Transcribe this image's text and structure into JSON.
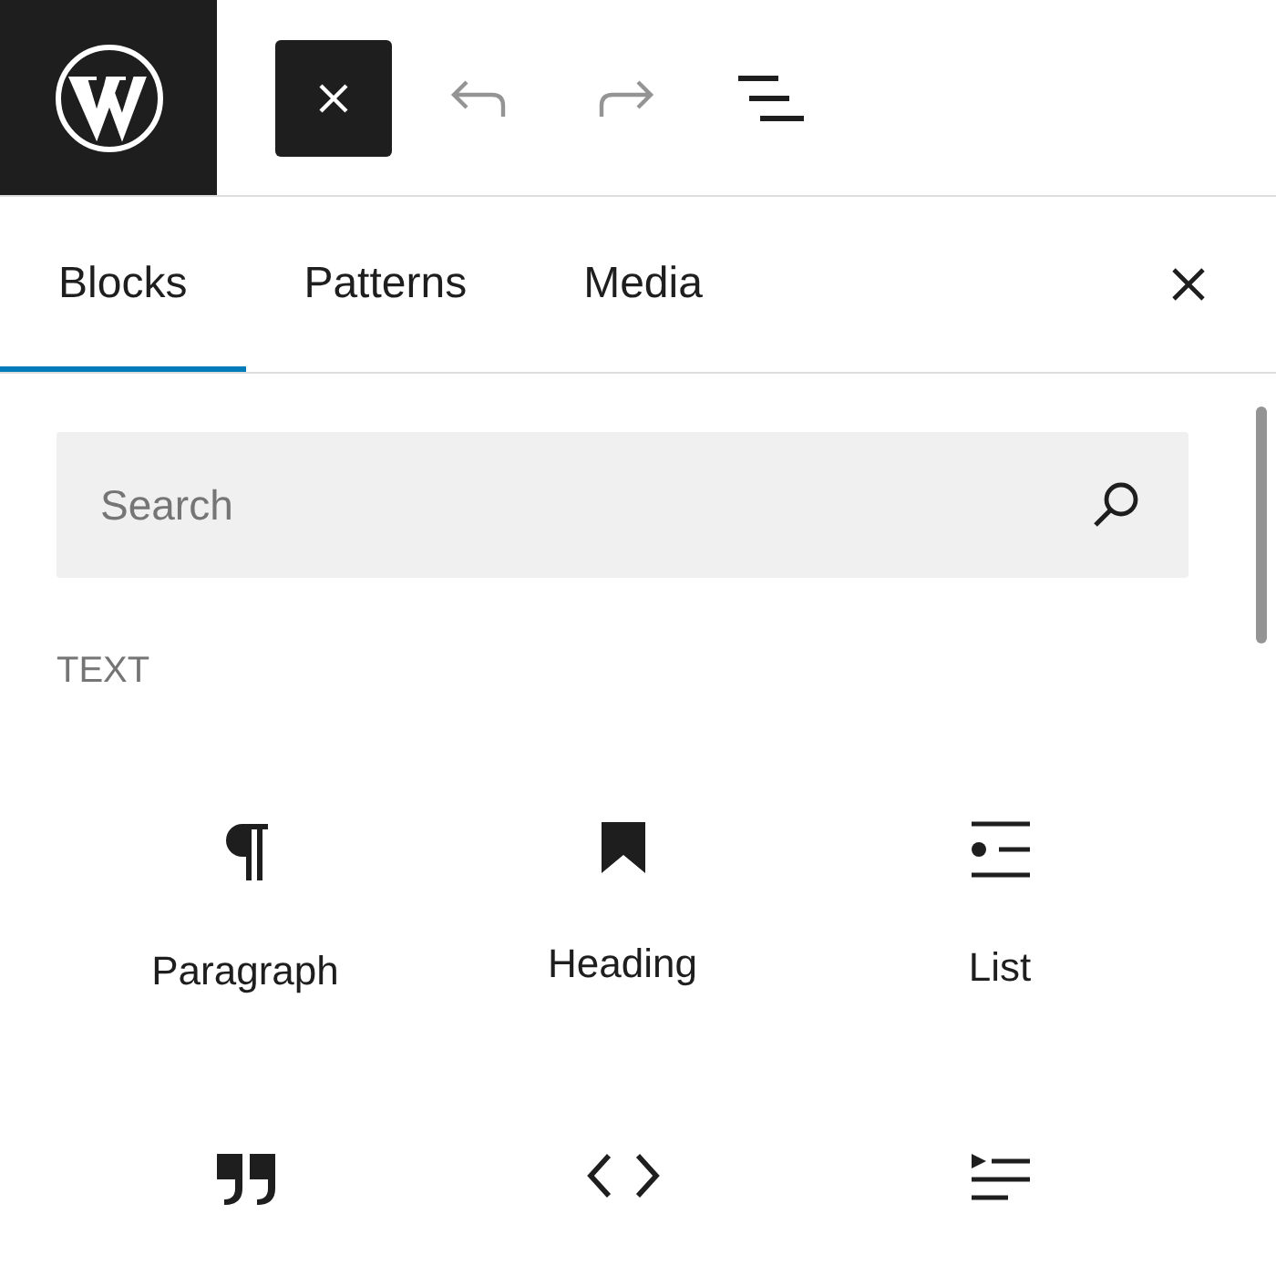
{
  "toolbar": {
    "buttons": [
      {
        "kind": "logo"
      },
      {
        "kind": "close"
      },
      {
        "kind": "undo",
        "disabled": true
      },
      {
        "kind": "redo",
        "disabled": true
      },
      {
        "kind": "listview",
        "disabled": false
      }
    ]
  },
  "inserter": {
    "tabs": [
      {
        "label": "Blocks",
        "selected": true
      },
      {
        "label": "Patterns",
        "selected": false
      },
      {
        "label": "Media",
        "selected": false
      }
    ],
    "search": {
      "placeholder": "Search"
    },
    "section_title": "TEXT",
    "blocks": [
      {
        "kind": "paragraph",
        "label": "Paragraph"
      },
      {
        "kind": "heading",
        "label": "Heading"
      },
      {
        "kind": "list",
        "label": "List"
      },
      {
        "kind": "quote"
      },
      {
        "kind": "code"
      },
      {
        "kind": "details"
      }
    ]
  }
}
